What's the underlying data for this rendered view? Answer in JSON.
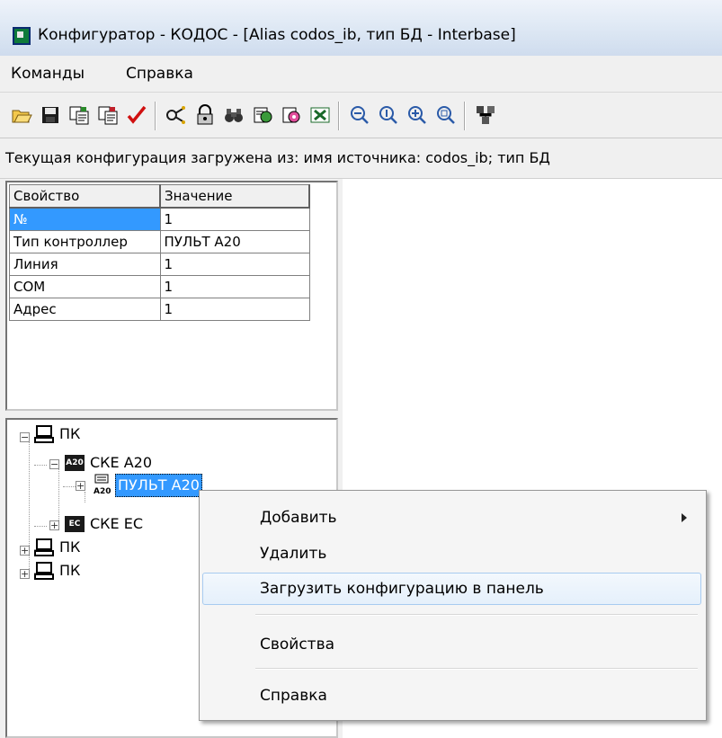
{
  "window": {
    "title": "Конфигуратор - КОДОС - [Alias codos_ib, тип БД - Interbase]"
  },
  "menu": {
    "items": [
      "Команды",
      "Справка"
    ]
  },
  "toolbar": {
    "buttons": [
      "open-icon",
      "save-icon",
      "copy-config-icon",
      "paste-config-icon",
      "check-icon",
      "connect-icon",
      "lock-icon",
      "find-icon",
      "report-icon",
      "settings-icon",
      "excel-icon",
      "zoom-out-icon",
      "zoom-reset-icon",
      "zoom-in-icon",
      "zoom-fit-icon",
      "network-icon"
    ]
  },
  "status": {
    "text": "Текущая конфигурация загружена из: имя источника: codos_ib; тип БД"
  },
  "properties": {
    "headers": [
      "Свойство",
      "Значение"
    ],
    "rows": [
      [
        "№",
        "1"
      ],
      [
        "Тип контроллер",
        "ПУЛЬТ А20"
      ],
      [
        "Линия",
        "1"
      ],
      [
        "COM",
        "1"
      ],
      [
        "Адрес",
        "1"
      ]
    ]
  },
  "tree": {
    "nodes": [
      {
        "label": "ПК"
      },
      {
        "label": "СКЕ А20",
        "icon_text": "A20"
      },
      {
        "label": "ПУЛЬТ А20",
        "icon_text": "A20"
      },
      {
        "label": "СКЕ ЕС",
        "icon_text": "EC"
      },
      {
        "label": "ПК"
      },
      {
        "label": "ПК"
      }
    ]
  },
  "context_menu": {
    "items": [
      {
        "label": "Добавить"
      },
      {
        "label": "Удалить"
      },
      {
        "label": "Загрузить конфигурацию в панель"
      },
      {
        "label": "Свойства"
      },
      {
        "label": "Справка"
      }
    ]
  },
  "colors": {
    "selection": "#3399ff",
    "menu_highlight_border": "#a8cbf0"
  }
}
